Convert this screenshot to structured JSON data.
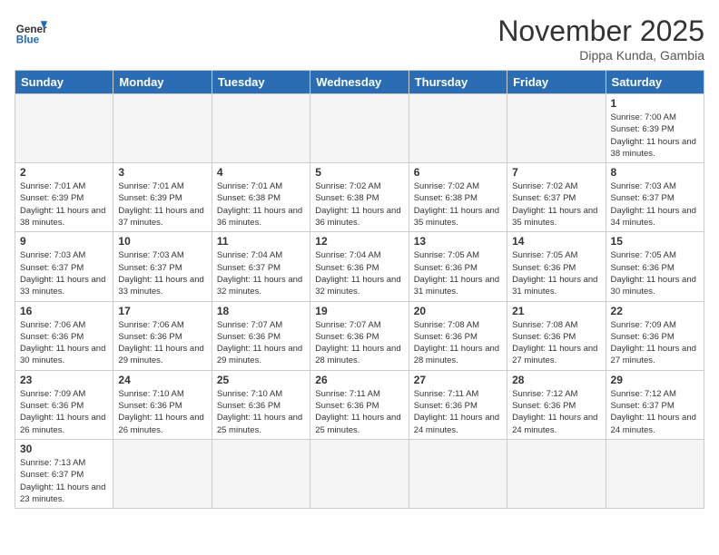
{
  "header": {
    "logo_general": "General",
    "logo_blue": "Blue",
    "month_title": "November 2025",
    "location": "Dippa Kunda, Gambia"
  },
  "weekdays": [
    "Sunday",
    "Monday",
    "Tuesday",
    "Wednesday",
    "Thursday",
    "Friday",
    "Saturday"
  ],
  "days": [
    {
      "date": "",
      "info": ""
    },
    {
      "date": "",
      "info": ""
    },
    {
      "date": "",
      "info": ""
    },
    {
      "date": "",
      "info": ""
    },
    {
      "date": "",
      "info": ""
    },
    {
      "date": "",
      "info": ""
    },
    {
      "date": "1",
      "sunrise": "7:00 AM",
      "sunset": "6:39 PM",
      "daylight": "11 hours and 38 minutes."
    },
    {
      "date": "2",
      "sunrise": "7:01 AM",
      "sunset": "6:39 PM",
      "daylight": "11 hours and 38 minutes."
    },
    {
      "date": "3",
      "sunrise": "7:01 AM",
      "sunset": "6:39 PM",
      "daylight": "11 hours and 37 minutes."
    },
    {
      "date": "4",
      "sunrise": "7:01 AM",
      "sunset": "6:38 PM",
      "daylight": "11 hours and 36 minutes."
    },
    {
      "date": "5",
      "sunrise": "7:02 AM",
      "sunset": "6:38 PM",
      "daylight": "11 hours and 36 minutes."
    },
    {
      "date": "6",
      "sunrise": "7:02 AM",
      "sunset": "6:38 PM",
      "daylight": "11 hours and 35 minutes."
    },
    {
      "date": "7",
      "sunrise": "7:02 AM",
      "sunset": "6:37 PM",
      "daylight": "11 hours and 35 minutes."
    },
    {
      "date": "8",
      "sunrise": "7:03 AM",
      "sunset": "6:37 PM",
      "daylight": "11 hours and 34 minutes."
    },
    {
      "date": "9",
      "sunrise": "7:03 AM",
      "sunset": "6:37 PM",
      "daylight": "11 hours and 33 minutes."
    },
    {
      "date": "10",
      "sunrise": "7:03 AM",
      "sunset": "6:37 PM",
      "daylight": "11 hours and 33 minutes."
    },
    {
      "date": "11",
      "sunrise": "7:04 AM",
      "sunset": "6:37 PM",
      "daylight": "11 hours and 32 minutes."
    },
    {
      "date": "12",
      "sunrise": "7:04 AM",
      "sunset": "6:36 PM",
      "daylight": "11 hours and 32 minutes."
    },
    {
      "date": "13",
      "sunrise": "7:05 AM",
      "sunset": "6:36 PM",
      "daylight": "11 hours and 31 minutes."
    },
    {
      "date": "14",
      "sunrise": "7:05 AM",
      "sunset": "6:36 PM",
      "daylight": "11 hours and 31 minutes."
    },
    {
      "date": "15",
      "sunrise": "7:05 AM",
      "sunset": "6:36 PM",
      "daylight": "11 hours and 30 minutes."
    },
    {
      "date": "16",
      "sunrise": "7:06 AM",
      "sunset": "6:36 PM",
      "daylight": "11 hours and 30 minutes."
    },
    {
      "date": "17",
      "sunrise": "7:06 AM",
      "sunset": "6:36 PM",
      "daylight": "11 hours and 29 minutes."
    },
    {
      "date": "18",
      "sunrise": "7:07 AM",
      "sunset": "6:36 PM",
      "daylight": "11 hours and 29 minutes."
    },
    {
      "date": "19",
      "sunrise": "7:07 AM",
      "sunset": "6:36 PM",
      "daylight": "11 hours and 28 minutes."
    },
    {
      "date": "20",
      "sunrise": "7:08 AM",
      "sunset": "6:36 PM",
      "daylight": "11 hours and 28 minutes."
    },
    {
      "date": "21",
      "sunrise": "7:08 AM",
      "sunset": "6:36 PM",
      "daylight": "11 hours and 27 minutes."
    },
    {
      "date": "22",
      "sunrise": "7:09 AM",
      "sunset": "6:36 PM",
      "daylight": "11 hours and 27 minutes."
    },
    {
      "date": "23",
      "sunrise": "7:09 AM",
      "sunset": "6:36 PM",
      "daylight": "11 hours and 26 minutes."
    },
    {
      "date": "24",
      "sunrise": "7:10 AM",
      "sunset": "6:36 PM",
      "daylight": "11 hours and 26 minutes."
    },
    {
      "date": "25",
      "sunrise": "7:10 AM",
      "sunset": "6:36 PM",
      "daylight": "11 hours and 25 minutes."
    },
    {
      "date": "26",
      "sunrise": "7:11 AM",
      "sunset": "6:36 PM",
      "daylight": "11 hours and 25 minutes."
    },
    {
      "date": "27",
      "sunrise": "7:11 AM",
      "sunset": "6:36 PM",
      "daylight": "11 hours and 24 minutes."
    },
    {
      "date": "28",
      "sunrise": "7:12 AM",
      "sunset": "6:36 PM",
      "daylight": "11 hours and 24 minutes."
    },
    {
      "date": "29",
      "sunrise": "7:12 AM",
      "sunset": "6:37 PM",
      "daylight": "11 hours and 24 minutes."
    },
    {
      "date": "30",
      "sunrise": "7:13 AM",
      "sunset": "6:37 PM",
      "daylight": "11 hours and 23 minutes."
    }
  ]
}
